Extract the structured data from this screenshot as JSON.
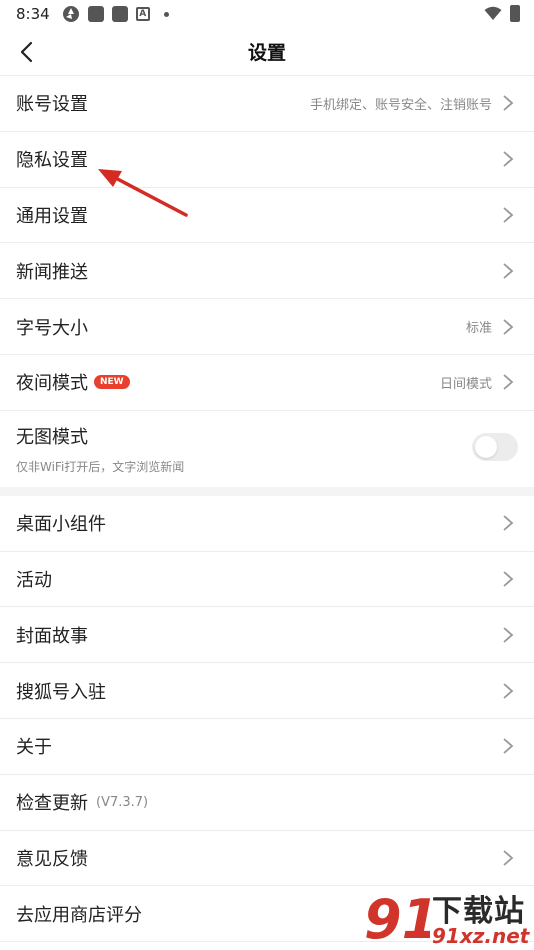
{
  "status_bar": {
    "time": "8:34",
    "notif_letter": "A"
  },
  "nav": {
    "title": "设置"
  },
  "rows": [
    {
      "label": "账号设置",
      "value": "手机绑定、账号安全、注销账号"
    },
    {
      "label": "隐私设置",
      "value": ""
    },
    {
      "label": "通用设置",
      "value": ""
    },
    {
      "label": "新闻推送",
      "value": ""
    },
    {
      "label": "字号大小",
      "value": "标准"
    },
    {
      "label": "夜间模式",
      "badge": "NEW",
      "value": "日间模式"
    },
    {
      "label": "无图模式",
      "subtitle": "仅非WiFi打开后，文字浏览新闻",
      "toggle": false
    },
    {
      "label": "桌面小组件",
      "value": ""
    },
    {
      "label": "活动",
      "value": ""
    },
    {
      "label": "封面故事",
      "value": ""
    },
    {
      "label": "搜狐号入驻",
      "value": ""
    },
    {
      "label": "关于",
      "value": ""
    },
    {
      "label": "检查更新",
      "version": "(V7.3.7)"
    },
    {
      "label": "意见反馈",
      "value": ""
    },
    {
      "label": "去应用商店评分",
      "value": ""
    }
  ],
  "watermark": {
    "title": "下载站",
    "url": "91xz.net",
    "logo_text": "91"
  },
  "colors": {
    "accent_red": "#e8402d",
    "annotation_red": "#d42b22",
    "divider": "#ececec"
  }
}
